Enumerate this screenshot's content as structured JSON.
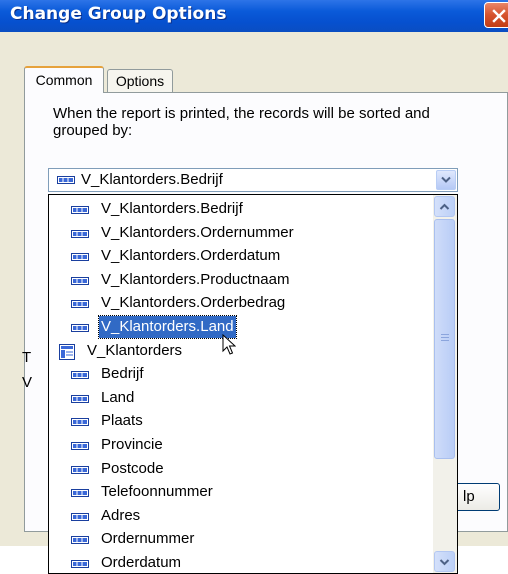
{
  "window": {
    "title": "Change Group Options"
  },
  "tabs": [
    {
      "label": "Common",
      "active": true
    },
    {
      "label": "Options",
      "active": false
    }
  ],
  "description": "When the report is printed, the records will be sorted and grouped by:",
  "combo": {
    "selected_value": "V_Klantorders.Bedrijf",
    "icon": "field-icon"
  },
  "dropdown": {
    "items": [
      {
        "label": "V_Klantorders.Bedrijf",
        "icon": "field-icon",
        "indent": 1,
        "selected": false
      },
      {
        "label": "V_Klantorders.Ordernummer",
        "icon": "field-icon",
        "indent": 1,
        "selected": false
      },
      {
        "label": "V_Klantorders.Orderdatum",
        "icon": "field-icon",
        "indent": 1,
        "selected": false
      },
      {
        "label": "V_Klantorders.Productnaam",
        "icon": "field-icon",
        "indent": 1,
        "selected": false
      },
      {
        "label": "V_Klantorders.Orderbedrag",
        "icon": "field-icon",
        "indent": 1,
        "selected": false
      },
      {
        "label": "V_Klantorders.Land",
        "icon": "field-icon",
        "indent": 1,
        "selected": true
      },
      {
        "label": "V_Klantorders",
        "icon": "table-icon",
        "indent": 0,
        "selected": false
      },
      {
        "label": "Bedrijf",
        "icon": "field-icon",
        "indent": 1,
        "selected": false
      },
      {
        "label": "Land",
        "icon": "field-icon",
        "indent": 1,
        "selected": false
      },
      {
        "label": "Plaats",
        "icon": "field-icon",
        "indent": 1,
        "selected": false
      },
      {
        "label": "Provincie",
        "icon": "field-icon",
        "indent": 1,
        "selected": false
      },
      {
        "label": "Postcode",
        "icon": "field-icon",
        "indent": 1,
        "selected": false
      },
      {
        "label": "Telefoonnummer",
        "icon": "field-icon",
        "indent": 1,
        "selected": false
      },
      {
        "label": "Adres",
        "icon": "field-icon",
        "indent": 1,
        "selected": false
      },
      {
        "label": "Ordernummer",
        "icon": "field-icon",
        "indent": 1,
        "selected": false
      },
      {
        "label": "Orderdatum",
        "icon": "field-icon",
        "indent": 1,
        "selected": false
      }
    ]
  },
  "background_partial": {
    "t_text": "T",
    "v_text": "V",
    "help_button_partial": "lp"
  },
  "colors": {
    "titlebar": "#0a5ad9",
    "selection": "#316ac5",
    "dialog_bg": "#ece9d8"
  }
}
